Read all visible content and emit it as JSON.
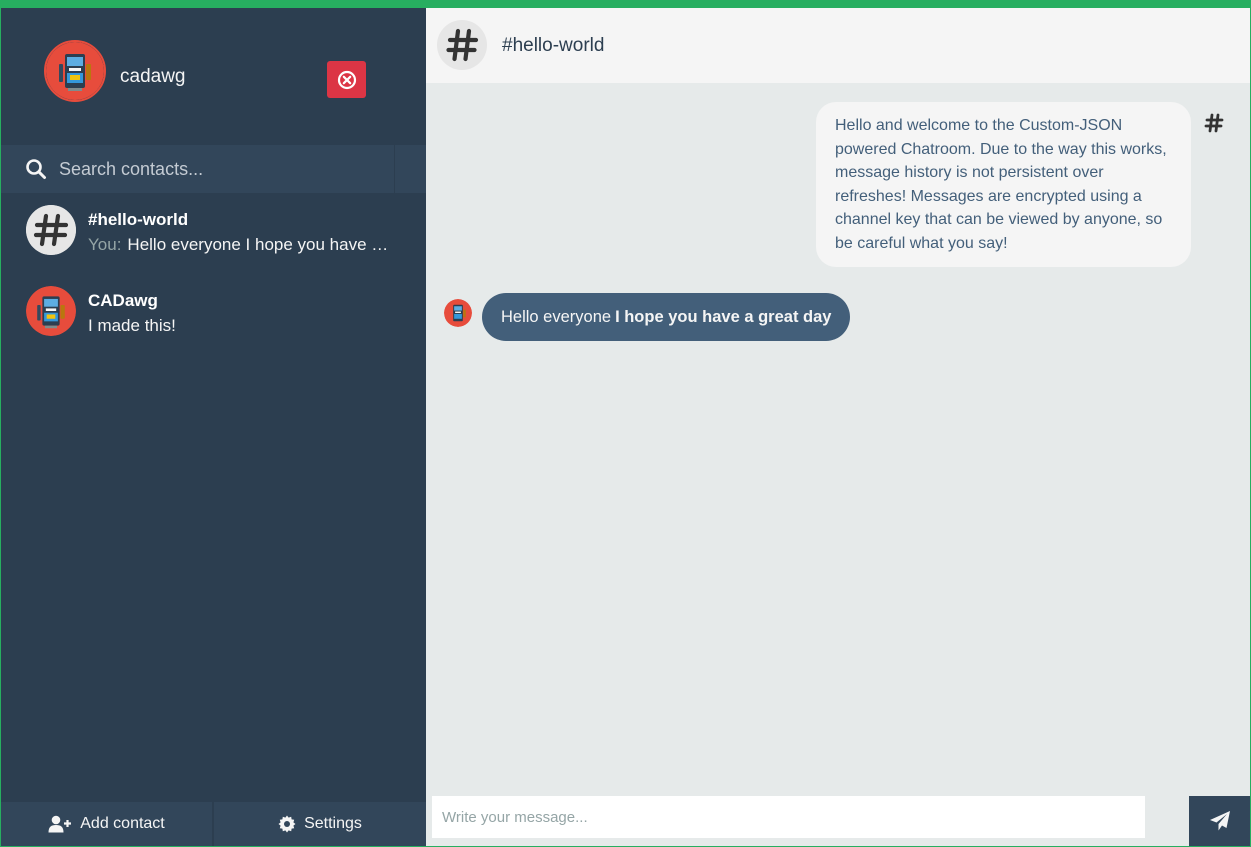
{
  "user": {
    "name": "cadawg",
    "avatar_icon": "robot-avatar-icon",
    "logout_icon": "close-circle-icon"
  },
  "search": {
    "placeholder": "Search contacts..."
  },
  "contacts": [
    {
      "name": "#hello-world",
      "prefix": "You:",
      "preview": "Hello everyone I hope you have a great day",
      "avatar_icon": "hashtag-icon"
    },
    {
      "name": "CADawg",
      "prefix": "",
      "preview": "I made this!",
      "avatar_icon": "robot-avatar-icon"
    }
  ],
  "bottom_bar": {
    "add_contact_label": "Add contact",
    "settings_label": "Settings"
  },
  "chat": {
    "title": "#hello-world",
    "messages": [
      {
        "direction": "incoming",
        "text": "Hello and welcome to the Custom-JSON powered Chatroom. Due to the way this works, message history is not persistent over refreshes! Messages are encrypted using a channel key that can be viewed by anyone, so be careful what you say!"
      },
      {
        "direction": "outgoing",
        "text_plain": "Hello everyone",
        "text_bold": "I hope you have a great day"
      }
    ],
    "compose_placeholder": "Write your message..."
  },
  "colors": {
    "accent_green": "#27ae60",
    "sidebar": "#2c3e50",
    "sidebar_light": "#32465a",
    "chat_bg": "#e6eaea",
    "danger": "#dc3545",
    "bubble_out": "#435f7a"
  }
}
